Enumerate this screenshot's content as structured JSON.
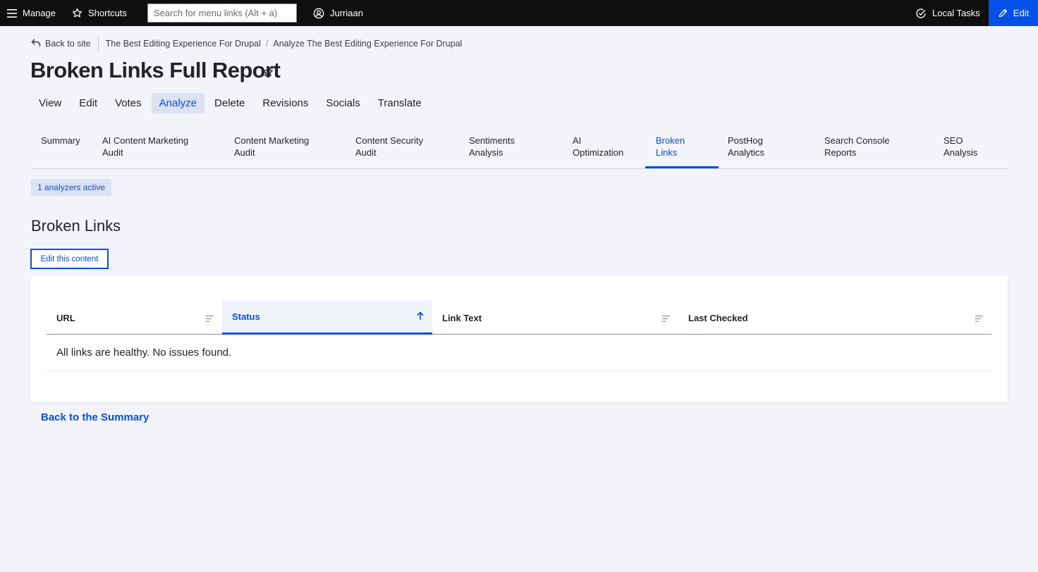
{
  "toolbar": {
    "manage_label": "Manage",
    "shortcuts_label": "Shortcuts",
    "search_placeholder": "Search for menu links (Alt + a)",
    "user_label": "Jurriaan",
    "local_tasks_label": "Local Tasks",
    "edit_label": "Edit"
  },
  "breadcrumb": {
    "back_label": "Back to site",
    "items": [
      "The Best Editing Experience For Drupal",
      "Analyze The Best Editing Experience For Drupal"
    ]
  },
  "page": {
    "title": "Broken Links Full Report"
  },
  "primary_tabs": [
    {
      "label": "View"
    },
    {
      "label": "Edit"
    },
    {
      "label": "Votes"
    },
    {
      "label": "Analyze",
      "active": true
    },
    {
      "label": "Delete"
    },
    {
      "label": "Revisions"
    },
    {
      "label": "Socials"
    },
    {
      "label": "Translate"
    }
  ],
  "secondary_tabs": [
    {
      "line1": "Summary",
      "line2": ""
    },
    {
      "line1": "AI Content Marketing",
      "line2": "Audit"
    },
    {
      "line1": "Content Marketing",
      "line2": "Audit"
    },
    {
      "line1": "Content Security",
      "line2": "Audit"
    },
    {
      "line1": "Sentiments",
      "line2": "Analysis"
    },
    {
      "line1": "AI",
      "line2": "Optimization"
    },
    {
      "line1": "Broken",
      "line2": "Links",
      "active": true
    },
    {
      "line1": "PostHog",
      "line2": "Analytics"
    },
    {
      "line1": "Search Console",
      "line2": "Reports"
    },
    {
      "line1": "SEO",
      "line2": "Analysis"
    }
  ],
  "badge": "1 analyzers active",
  "section": {
    "title": "Broken Links",
    "edit_button": "Edit this content"
  },
  "table": {
    "columns": [
      {
        "label": "URL",
        "icon": "sort-lines-icon"
      },
      {
        "label": "Status",
        "icon": "sort-arrow-up-icon",
        "sorted": true
      },
      {
        "label": "Link Text",
        "icon": "sort-lines-icon"
      },
      {
        "label": "Last Checked",
        "icon": "sort-lines-icon"
      }
    ],
    "empty_message": "All links are healthy. No issues found."
  },
  "footer_link": "Back to the Summary",
  "colors": {
    "accent": "#0550e6",
    "toolbar_bg": "#0f0f0f",
    "page_bg": "#f3f4f9",
    "active_tab_bg": "#dde2f3"
  }
}
